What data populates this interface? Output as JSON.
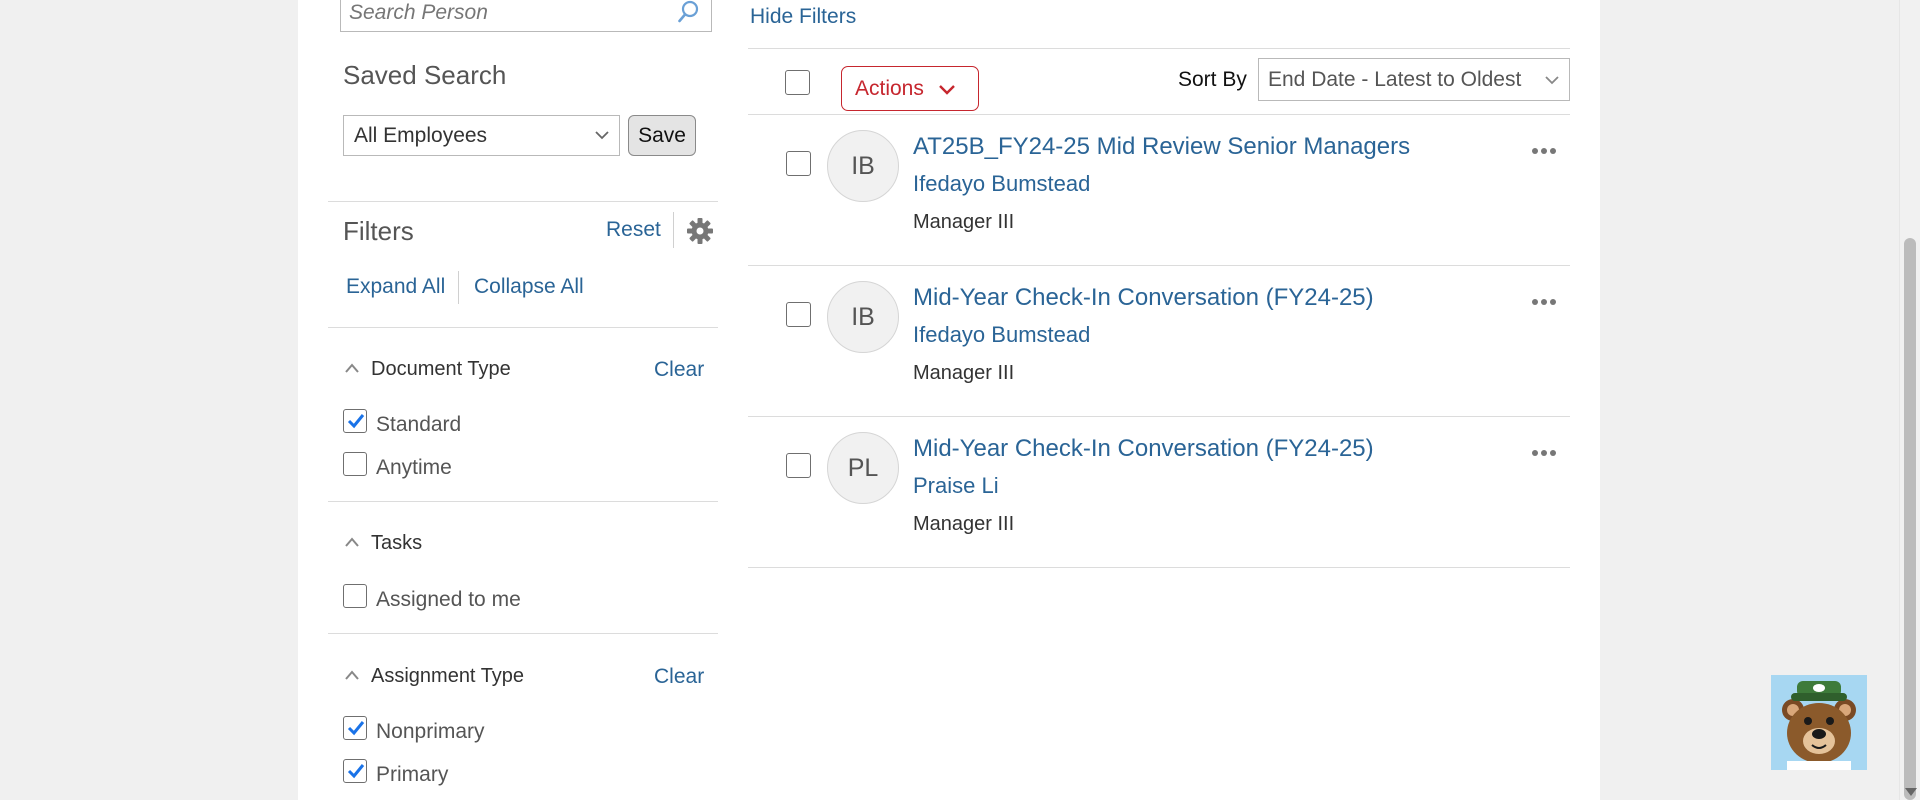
{
  "search": {
    "placeholder": "Search Person"
  },
  "saved_search": {
    "title": "Saved Search",
    "selected": "All Employees",
    "save_label": "Save"
  },
  "filters": {
    "title": "Filters",
    "reset_label": "Reset",
    "expand_all_label": "Expand All",
    "collapse_all_label": "Collapse All",
    "sections": [
      {
        "title": "Document Type",
        "clear_label": "Clear",
        "options": [
          {
            "label": "Standard",
            "checked": true
          },
          {
            "label": "Anytime",
            "checked": false
          }
        ]
      },
      {
        "title": "Tasks",
        "options": [
          {
            "label": "Assigned to me",
            "checked": false
          }
        ]
      },
      {
        "title": "Assignment Type",
        "clear_label": "Clear",
        "options": [
          {
            "label": "Nonprimary",
            "checked": true
          },
          {
            "label": "Primary",
            "checked": true
          }
        ]
      }
    ]
  },
  "toolbar": {
    "hide_filters_label": "Hide Filters",
    "actions_label": "Actions",
    "sort_by_label": "Sort By",
    "sort_value": "End Date - Latest to Oldest"
  },
  "results": [
    {
      "initials": "IB",
      "title": "AT25B_FY24-25 Mid Review Senior Managers",
      "person": "Ifedayo Bumstead",
      "role": "Manager III"
    },
    {
      "initials": "IB",
      "title": "Mid-Year Check-In Conversation (FY24-25)",
      "person": "Ifedayo Bumstead",
      "role": "Manager III"
    },
    {
      "initials": "PL",
      "title": "Mid-Year Check-In Conversation (FY24-25)",
      "person": "Praise Li",
      "role": "Manager III"
    }
  ],
  "colors": {
    "link": "#2a6496",
    "actions": "#c6262e",
    "checkbox_checked": "#1a73e8"
  },
  "icons": {
    "search": "search-icon",
    "gear": "gear-icon",
    "more": "more-options-icon",
    "chevron": "chevron-down-icon",
    "mascot": "bear-mascot-icon"
  }
}
